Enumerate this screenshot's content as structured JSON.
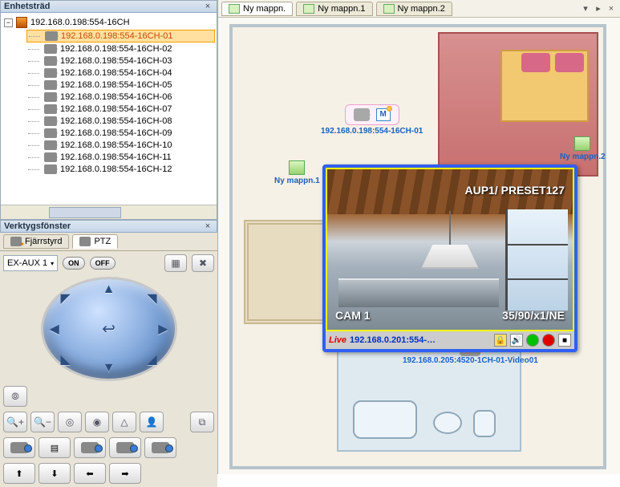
{
  "tree": {
    "panel_title": "Enhetsträd",
    "root": "192.168.0.198:554-16CH",
    "expander": "−",
    "items": [
      "192.168.0.198:554-16CH-01",
      "192.168.0.198:554-16CH-02",
      "192.168.0.198:554-16CH-03",
      "192.168.0.198:554-16CH-04",
      "192.168.0.198:554-16CH-05",
      "192.168.0.198:554-16CH-06",
      "192.168.0.198:554-16CH-07",
      "192.168.0.198:554-16CH-08",
      "192.168.0.198:554-16CH-09",
      "192.168.0.198:554-16CH-10",
      "192.168.0.198:554-16CH-11",
      "192.168.0.198:554-16CH-12"
    ],
    "selected_index": 0
  },
  "tool": {
    "panel_title": "Verktygsfönster",
    "tab_remote": "Fjärrstyrd",
    "tab_ptz": "PTZ",
    "aux_select": "EX-AUX 1",
    "on_label": "ON",
    "off_label": "OFF",
    "buttons": {
      "autofocus": "⦾",
      "zoom_in": "🔍+",
      "zoom_out": "🔍−",
      "focus_near": "◎",
      "focus_far": "◉",
      "iris_open": "△",
      "person": "👤",
      "capture": "⧉",
      "arr_up": "⬆",
      "arr_down": "⬇",
      "arr_left": "⬅",
      "arr_right": "➡"
    }
  },
  "doc_tabs": {
    "t0": "Ny mappn.",
    "t1": "Ny mappn.1",
    "t2": "Ny mappn.2"
  },
  "map_nodes": {
    "n1": "Ny mappn.1",
    "n2": "Ny mappn.2",
    "cam1_label": "192.168.0.198:554-16CH-01",
    "cam1_m": "M",
    "ptz_label": "192.168.0.205:4520-1CH-01-Video01"
  },
  "live": {
    "osd_tr": "AUP1/ PRESET127",
    "osd_bl": "CAM 1",
    "osd_br": "35/90/x1/NE",
    "live_label": "Live",
    "address": "192.168.0.201:554-…"
  },
  "glyphs": {
    "close": "×",
    "dropdown": "▾",
    "pin": "▸"
  }
}
